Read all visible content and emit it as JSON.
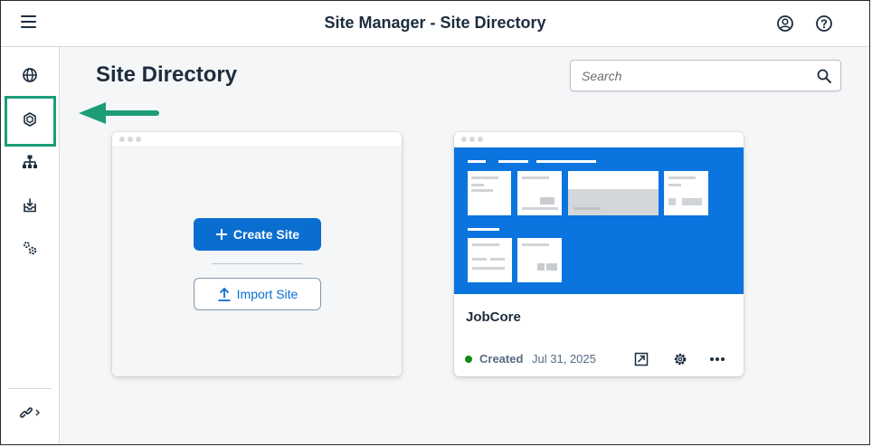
{
  "header": {
    "title": "Site Manager - Site Directory",
    "menu_icon": "hamburger-menu-icon",
    "profile_icon": "user-profile-icon",
    "help_icon": "help-icon"
  },
  "sidenav": {
    "items": [
      {
        "icon": "globe-icon"
      },
      {
        "icon": "site-cube-icon",
        "highlighted": true
      },
      {
        "icon": "hierarchy-icon"
      },
      {
        "icon": "inbox-download-icon"
      },
      {
        "icon": "settings-gears-icon"
      }
    ],
    "footer_icon": "link-expand-icon",
    "highlight_color": "#1c9d78"
  },
  "page": {
    "title": "Site Directory",
    "search_placeholder": "Search"
  },
  "create_card": {
    "create_label": "Create Site",
    "import_label": "Import Site"
  },
  "site_card": {
    "name": "JobCore",
    "status": "Created",
    "date": "Jul 31, 2025",
    "actions": [
      "export-icon",
      "settings-icon",
      "more-icon"
    ]
  },
  "colors": {
    "accent": "#0a6ed1",
    "thumbnail_bg": "#0b74de",
    "status_positive": "#188918",
    "arrow": "#1c9d78"
  }
}
